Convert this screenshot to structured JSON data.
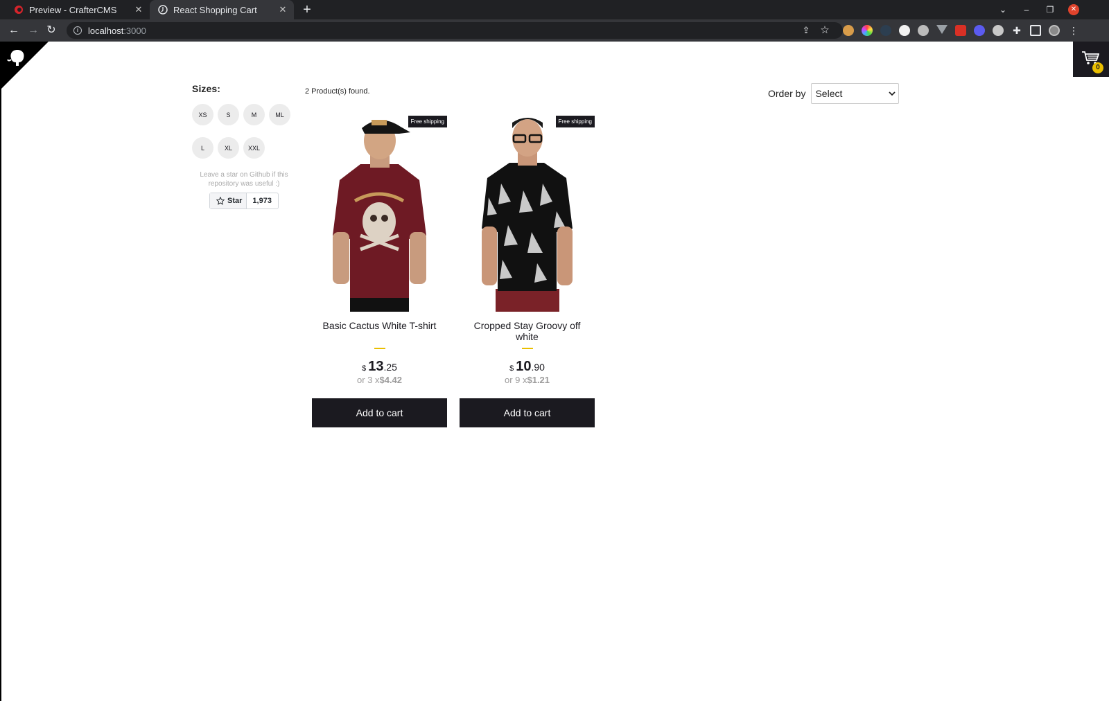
{
  "browser": {
    "tabs": [
      {
        "title": "Preview - CrafterCMS",
        "active": false
      },
      {
        "title": "React Shopping Cart",
        "active": true
      }
    ],
    "url_host": "localhost",
    "url_port": ":3000",
    "extension_icons": [
      "share-icon",
      "bookmark-star-icon",
      "cookie-extension-icon",
      "color-ring-extension-icon",
      "dark-extension-icon",
      "white-circle-extension-icon",
      "gear-circle-extension-icon",
      "vue-devtools-icon",
      "red-extension-icon",
      "blue-gear-extension-icon",
      "gray-circle-extension-icon",
      "puzzle-extensions-icon",
      "sidebar-panel-icon",
      "profile-avatar-icon",
      "menu-kebab-icon"
    ]
  },
  "cart": {
    "count": "0"
  },
  "filters": {
    "title": "Sizes:",
    "sizes": [
      "XS",
      "S",
      "M",
      "ML",
      "L",
      "XL",
      "XXL"
    ],
    "github_note": "Leave a star on Github if this repository was useful :)",
    "star_label": "Star",
    "star_count": "1,973"
  },
  "shelf": {
    "found_text": "2 Product(s) found.",
    "order_label": "Order by",
    "order_value": "Select"
  },
  "products": [
    {
      "badge": "Free shipping",
      "title": "Basic Cactus White T-shirt",
      "currency": "$",
      "price_int": "13",
      "price_dec": ".25",
      "installments_prefix": "or 3 x",
      "installments_value": "$4.42",
      "button": "Add to cart"
    },
    {
      "badge": "Free shipping",
      "title": "Cropped Stay Groovy off white",
      "currency": "$",
      "price_int": "10",
      "price_dec": ".90",
      "installments_prefix": "or 9 x",
      "installments_value": "$1.21",
      "button": "Add to cart"
    }
  ],
  "colors": {
    "dark": "#1b1a20",
    "accent": "#eabf00",
    "muted": "#9c9b9b"
  }
}
